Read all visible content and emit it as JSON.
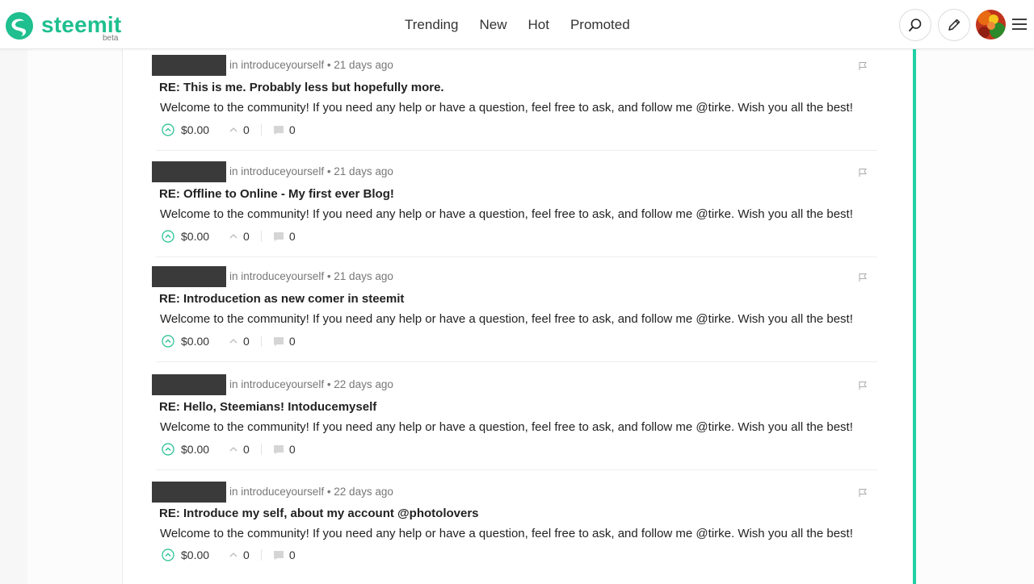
{
  "brand": {
    "name": "steemit",
    "badge": "beta",
    "color": "#1fbf8f"
  },
  "nav": [
    {
      "label": "Trending"
    },
    {
      "label": "New"
    },
    {
      "label": "Hot"
    },
    {
      "label": "Promoted"
    }
  ],
  "header_icons": [
    "search-icon",
    "pencil-icon",
    "avatar",
    "hamburger-menu-icon"
  ],
  "accent_color": "#1fd1a5",
  "items": [
    {
      "meta": "in introduceyourself • 21 days ago",
      "title": "RE: This is me. Probably less but hopefully more.",
      "body": "Welcome to the community! If you need any help or have a question, feel free to ask, and follow me @tirke. Wish you all the best!",
      "payout": "$0.00",
      "votes": "0",
      "comments": "0"
    },
    {
      "meta": "in introduceyourself • 21 days ago",
      "title": "RE: Offline to Online - My first ever Blog!",
      "body": "Welcome to the community! If you need any help or have a question, feel free to ask, and follow me @tirke. Wish you all the best!",
      "payout": "$0.00",
      "votes": "0",
      "comments": "0"
    },
    {
      "meta": "in introduceyourself • 21 days ago",
      "title": "RE: Introducetion as new comer in steemit",
      "body": "Welcome to the community! If you need any help or have a question, feel free to ask, and follow me @tirke. Wish you all the best!",
      "payout": "$0.00",
      "votes": "0",
      "comments": "0"
    },
    {
      "meta": "in introduceyourself • 22 days ago",
      "title": "RE: Hello, Steemians! Intoducemyself",
      "body": "Welcome to the community! If you need any help or have a question, feel free to ask, and follow me @tirke. Wish you all the best!",
      "payout": "$0.00",
      "votes": "0",
      "comments": "0"
    },
    {
      "meta": "in introduceyourself • 22 days ago",
      "title": "RE: Introduce my self, about my account @photolovers",
      "body": "Welcome to the community! If you need any help or have a question, feel free to ask, and follow me @tirke. Wish you all the best!",
      "payout": "$0.00",
      "votes": "0",
      "comments": "0"
    }
  ]
}
